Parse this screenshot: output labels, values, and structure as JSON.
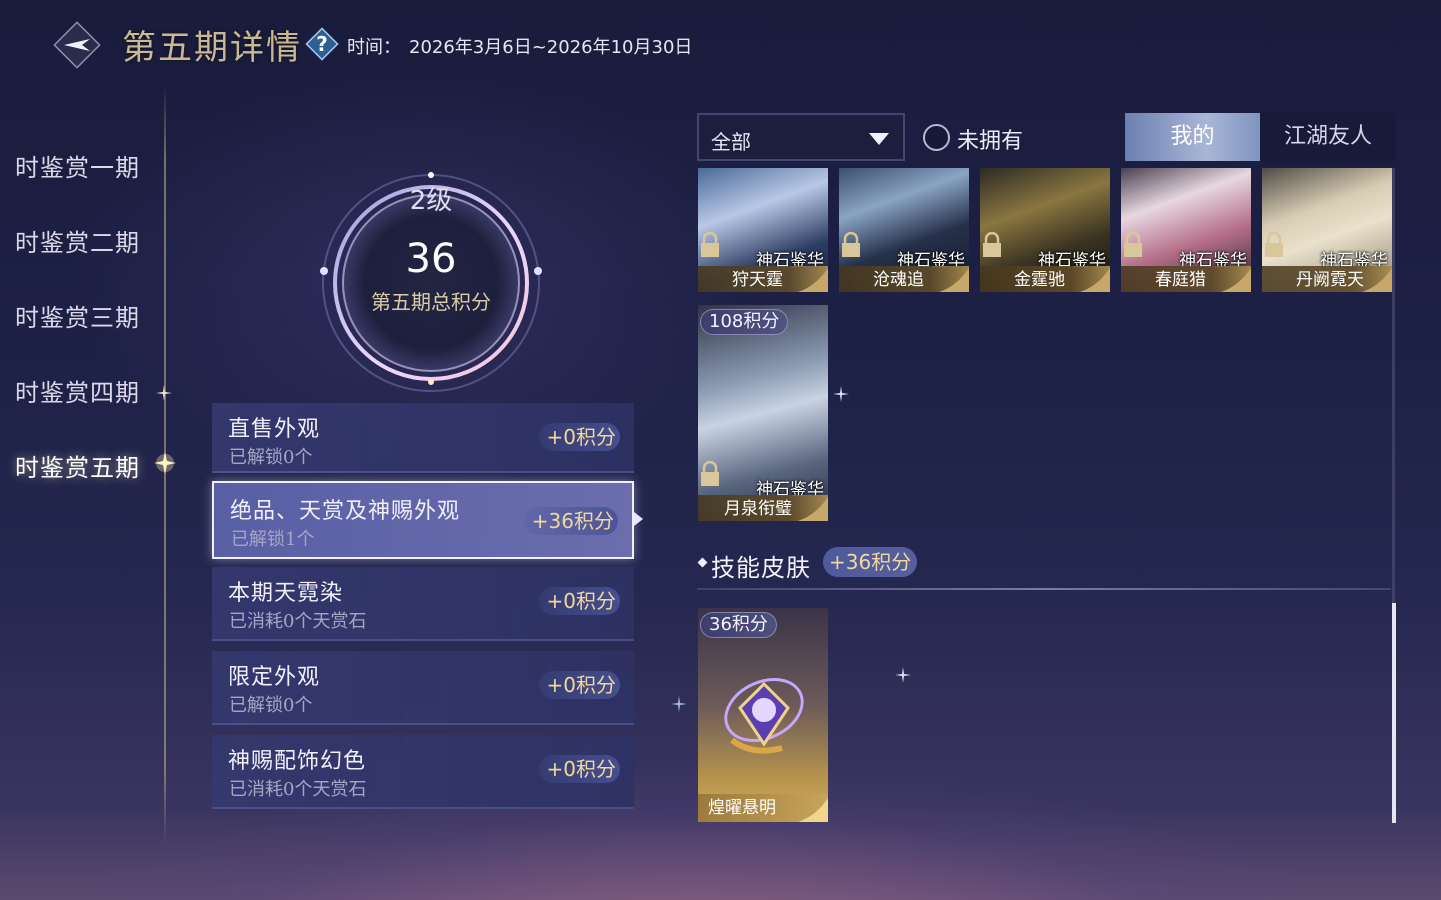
{
  "header": {
    "title": "第五期详情",
    "period_label": "时间：",
    "period_value": "2026年3月6日~2026年10月30日",
    "back_icon": "back-arrow-icon",
    "help_icon": "help-question-icon"
  },
  "nav": {
    "items": [
      {
        "label": "时鉴赏一期"
      },
      {
        "label": "时鉴赏二期"
      },
      {
        "label": "时鉴赏三期"
      },
      {
        "label": "时鉴赏四期"
      },
      {
        "label": "时鉴赏五期"
      }
    ],
    "active_index": 4
  },
  "score": {
    "level": "2级",
    "value": "36",
    "label": "第五期总积分"
  },
  "categories": [
    {
      "title": "直售外观",
      "sub": "已解锁0个",
      "points": "+0积分"
    },
    {
      "title": "绝品、天赏及神赐外观",
      "sub": "已解锁1个",
      "points": "+36积分",
      "active": true
    },
    {
      "title": "本期天霓染",
      "sub": "已消耗0个天赏石",
      "points": "+0积分"
    },
    {
      "title": "限定外观",
      "sub": "已解锁0个",
      "points": "+0积分"
    },
    {
      "title": "神赐配饰幻色",
      "sub": "已消耗0个天赏石",
      "points": "+0积分"
    }
  ],
  "filter": {
    "dropdown_value": "全部",
    "not_owned_label": "未拥有",
    "tabs": {
      "mine": "我的",
      "friends": "江湖友人"
    }
  },
  "cards": [
    {
      "line1": "神石鉴华",
      "line2": "狩天霆"
    },
    {
      "line1": "神石鉴华",
      "line2": "沧魂追"
    },
    {
      "line1": "神石鉴华",
      "line2": "金霆驰"
    },
    {
      "line1": "神石鉴华",
      "line2": "春庭猎"
    },
    {
      "line1": "神石鉴华",
      "line2": "丹阙霓天"
    },
    {
      "line1": "神石鉴华",
      "line2": "月泉衔璧",
      "tag": "108积分"
    }
  ],
  "skill_section": {
    "title": "技能皮肤",
    "points": "+36积分",
    "card": {
      "tag": "36积分",
      "name": "煌曜悬明"
    }
  },
  "colors": {
    "gold_text": "#f0d99a",
    "title_gold": "#c9b893",
    "panel": "#34386e",
    "tab_active": "#a9b6d6"
  }
}
